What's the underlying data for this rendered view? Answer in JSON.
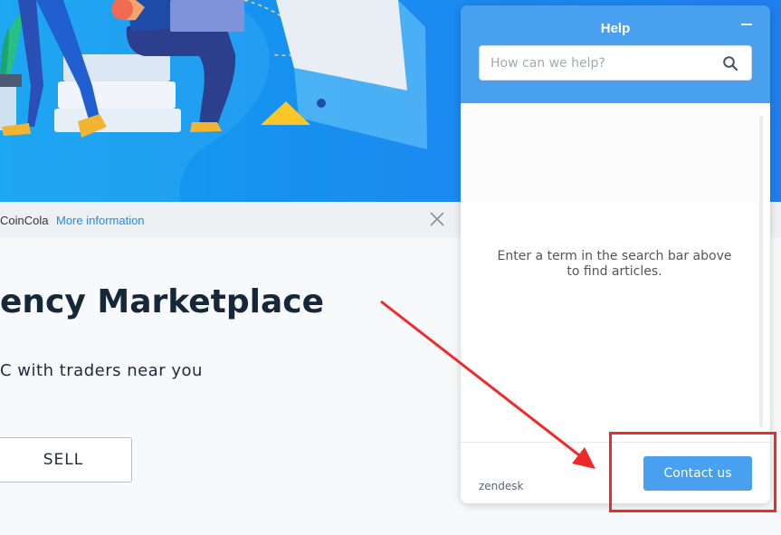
{
  "hero": {
    "illustration": "person-with-laptop-illustration"
  },
  "cookie_bar": {
    "text": "CoinCola",
    "link": "More information",
    "close_icon": "close-icon"
  },
  "main": {
    "title": "ency Marketplace",
    "subtitle": "C with traders near you",
    "sell_label": "SELL"
  },
  "help_widget": {
    "title": "Help",
    "minimize_icon": "minimize-icon",
    "search": {
      "placeholder": "How can we help?",
      "value": "",
      "icon": "search-icon"
    },
    "message_line1": "Enter a term in the search bar above",
    "message_line2": "to find articles.",
    "footer_logo": "zendesk",
    "contact_label": "Contact us"
  },
  "colors": {
    "accent": "#48a0ef",
    "hero_blue": "#1b8af0",
    "annotation_red": "#ef2a2a"
  }
}
